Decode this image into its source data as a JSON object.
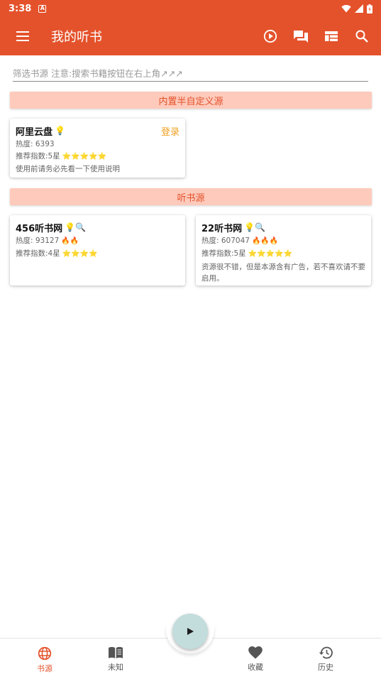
{
  "status_bar": {
    "time": "3:38",
    "notification_badge": "A"
  },
  "app_bar": {
    "title": "我的听书",
    "icons": [
      "menu-icon",
      "play-circle-icon",
      "chat-icon",
      "dashboard-icon",
      "search-icon"
    ]
  },
  "filter": {
    "placeholder": "筛选书源 注意:搜索书籍按钮在右上角↗↗↗",
    "value": ""
  },
  "sections": [
    {
      "title": "内置半自定义源",
      "cards": [
        {
          "name": "阿里云盘",
          "badge_emoji": "💡",
          "action": "登录",
          "heat_label": "热度: 6393",
          "fires": "",
          "rating_label": "推荐指数:5星",
          "stars": "⭐⭐⭐⭐⭐",
          "description": "使用前请务必先看一下使用说明"
        }
      ]
    },
    {
      "title": "听书源",
      "cards": [
        {
          "name": "456听书网",
          "badge_emoji": "💡🔍",
          "heat_label": "热度: 93127",
          "fires": "🔥🔥",
          "rating_label": "推荐指数:4星",
          "stars": "⭐⭐⭐⭐",
          "description": ""
        },
        {
          "name": "22听书网",
          "badge_emoji": "💡🔍",
          "heat_label": "热度: 607047",
          "fires": "🔥🔥🔥",
          "rating_label": "推荐指数:5星",
          "stars": "⭐⭐⭐⭐⭐",
          "description": "资源很不错，但是本源含有广告，若不喜欢请不要启用。"
        }
      ]
    }
  ],
  "bottom_nav": {
    "items": [
      {
        "label": "书源",
        "icon": "globe-icon",
        "active": true
      },
      {
        "label": "未知",
        "icon": "book-open-icon",
        "active": false
      },
      {
        "label": "收藏",
        "icon": "heart-icon",
        "active": false
      },
      {
        "label": "历史",
        "icon": "history-icon",
        "active": false
      }
    ],
    "fab_icon": "play-icon"
  },
  "colors": {
    "primary": "#e4522b",
    "section_bg": "#fecabb",
    "login": "#f0a020",
    "fab": "#c3dcdc"
  }
}
